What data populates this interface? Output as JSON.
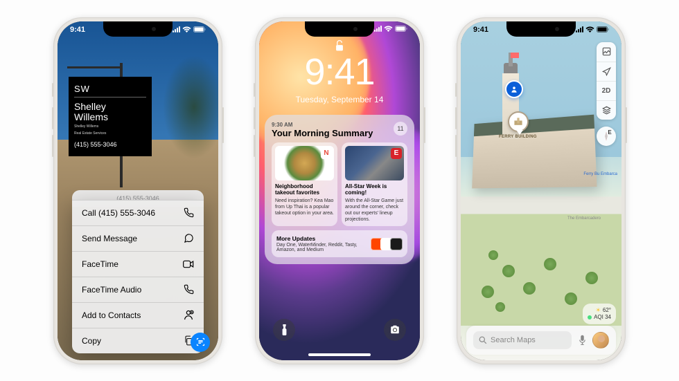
{
  "status_time": "9:41",
  "phone1": {
    "sign": {
      "logo": "SW",
      "name1": "Shelley",
      "name2": "Willems",
      "sub1": "Shelley Willems",
      "sub2": "Real Estate Services",
      "phone": "(415) 555-3046"
    },
    "menu_header": "(415) 555-3046",
    "items": [
      {
        "label": "Call (415) 555-3046",
        "icon": "phone"
      },
      {
        "label": "Send Message",
        "icon": "message"
      },
      {
        "label": "FaceTime",
        "icon": "video"
      },
      {
        "label": "FaceTime Audio",
        "icon": "phone"
      },
      {
        "label": "Add to Contacts",
        "icon": "person-add"
      },
      {
        "label": "Copy",
        "icon": "copy"
      }
    ]
  },
  "phone2": {
    "time": "9:41",
    "date": "Tuesday, September 14",
    "summary": {
      "timestamp": "9:30 AM",
      "title": "Your Morning Summary",
      "count": "11"
    },
    "card1": {
      "title": "Neighborhood takeout favorites",
      "body": "Need inspiration? Kea Mao from Up Thai is a popular takeout option in your area.",
      "badge": "N"
    },
    "card2": {
      "title": "All-Star Week is coming!",
      "body": "With the All-Star Game just around the corner, check out our experts' lineup projections.",
      "badge": "E"
    },
    "more": {
      "title": "More Updates",
      "body": "Day One, WaterMinder, Reddit, Tasty, Amazon, and Medium"
    }
  },
  "phone3": {
    "controls": {
      "nav": "location",
      "mode": "2D"
    },
    "compass": "E",
    "poi_name": "FERRY BUILDING",
    "ferry_label": "Ferry Bu Embarca",
    "weather": {
      "temp": "62°",
      "aqi": "AQI 34"
    },
    "search_placeholder": "Search Maps",
    "road_label": "The Embarcadero"
  }
}
